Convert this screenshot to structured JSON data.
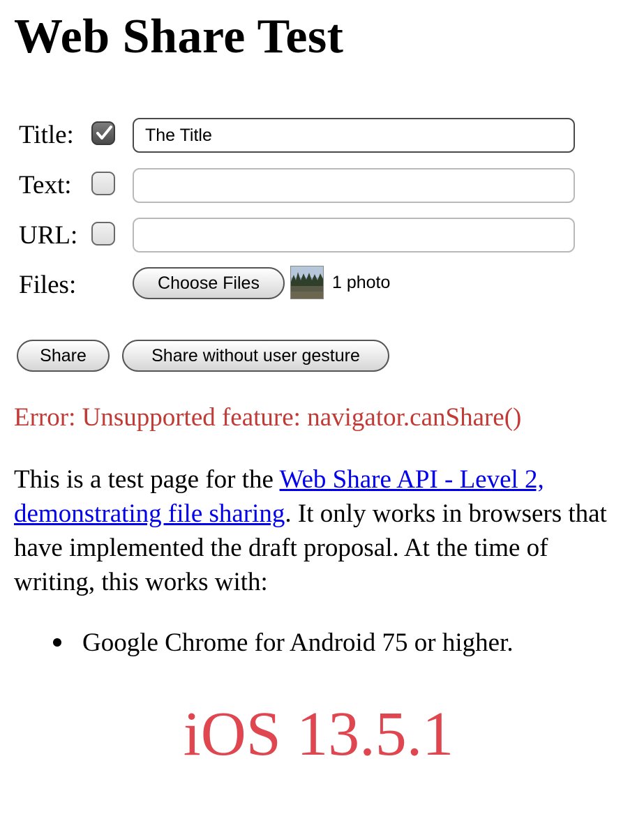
{
  "page": {
    "title": "Web Share Test"
  },
  "form": {
    "title_row": {
      "label": "Title:",
      "checked": true,
      "value": "The Title",
      "placeholder": ""
    },
    "text_row": {
      "label": "Text:",
      "checked": false,
      "value": "",
      "placeholder": ""
    },
    "url_row": {
      "label": "URL:",
      "checked": false,
      "value": "",
      "placeholder": ""
    },
    "files_row": {
      "label": "Files:",
      "choose_label": "Choose Files",
      "status": "1 photo",
      "thumbnail_icon": "photo-thumbnail-icon"
    }
  },
  "actions": {
    "share_label": "Share",
    "share_no_gesture_label": "Share without user gesture"
  },
  "error": {
    "message": "Error: Unsupported feature: navigator.canShare()",
    "color": "#c23a35"
  },
  "description": {
    "intro": "This is a test page for the ",
    "link_text": "Web Share API - Level 2, demonstrating file sharing",
    "outro": ". It only works in browsers that have implemented the draft proposal. At the time of writing, this works with:"
  },
  "browsers": [
    "Google Chrome for Android 75 or higher."
  ],
  "caption": {
    "text": "iOS 13.5.1",
    "color": "#e0464f"
  },
  "colors": {
    "link": "#0000ee",
    "background": "#ffffff"
  }
}
